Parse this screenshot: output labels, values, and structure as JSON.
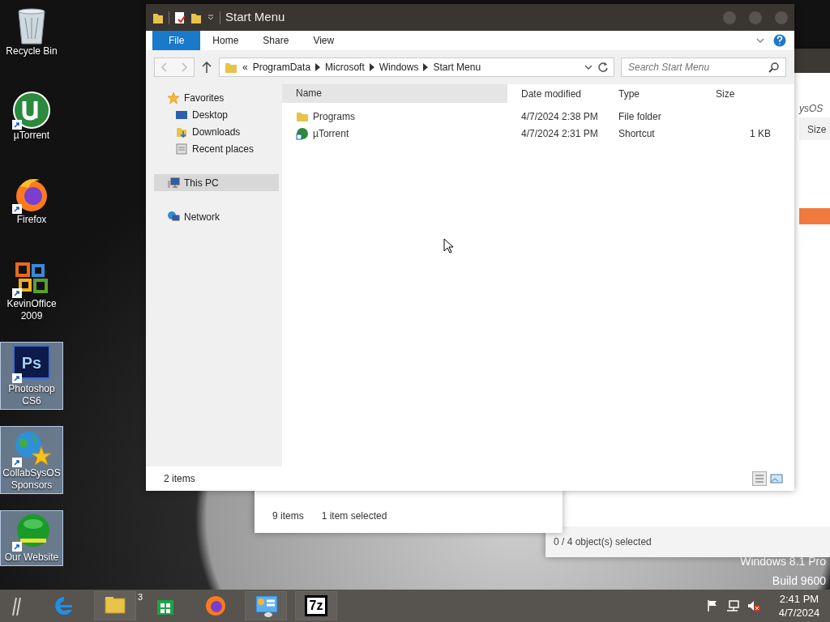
{
  "desktop": {
    "icons": [
      {
        "label": "Recycle Bin",
        "kind": "bin",
        "shortcut": false,
        "selected": false
      },
      {
        "label": "µTorrent",
        "kind": "utorrent",
        "shortcut": true,
        "selected": false
      },
      {
        "label": "Firefox",
        "kind": "firefox",
        "shortcut": true,
        "selected": false
      },
      {
        "label": "KevinOffice 2009",
        "kind": "office",
        "shortcut": true,
        "selected": false
      },
      {
        "label": "Photoshop CS6",
        "kind": "photoshop",
        "icon_text": "Ps",
        "shortcut": true,
        "selected": true
      },
      {
        "label": "CollabSysOS Sponsors",
        "kind": "globe",
        "shortcut": true,
        "selected": true
      },
      {
        "label": "Our Website",
        "kind": "website",
        "shortcut": true,
        "selected": true
      }
    ],
    "os_label": [
      "Windows 8.1 Pro",
      "Build 9600"
    ]
  },
  "back_window_right": {
    "heading": "ysOS",
    "column": "Size",
    "status": "0 / 4 object(s) selected"
  },
  "back_window_left": {
    "status": [
      "9 items",
      "1 item selected"
    ]
  },
  "explorer": {
    "title": "Start Menu",
    "ribbon_tabs": [
      {
        "label": "File",
        "selected": true
      },
      {
        "label": "Home",
        "selected": false
      },
      {
        "label": "Share",
        "selected": false
      },
      {
        "label": "View",
        "selected": false
      }
    ],
    "address": {
      "overflow": "«",
      "crumbs": [
        "ProgramData",
        "Microsoft",
        "Windows",
        "Start Menu"
      ]
    },
    "search": {
      "placeholder": "Search Start Menu"
    },
    "nav": [
      {
        "label": "Favorites",
        "kind": "star",
        "selected": false,
        "children": [
          {
            "label": "Desktop",
            "kind": "desktop",
            "selected": false
          },
          {
            "label": "Downloads",
            "kind": "downloads",
            "selected": false
          },
          {
            "label": "Recent places",
            "kind": "recent",
            "selected": false
          }
        ]
      },
      {
        "label": "This PC",
        "kind": "pc",
        "selected": true
      },
      {
        "label": "Network",
        "kind": "network",
        "selected": false
      }
    ],
    "columns": [
      "Name",
      "Date modified",
      "Type",
      "Size"
    ],
    "rows": [
      {
        "kind": "folder",
        "name": "Programs",
        "date": "4/7/2024 2:38 PM",
        "type": "File folder",
        "size": ""
      },
      {
        "kind": "shortcut",
        "name": "µTorrent",
        "date": "4/7/2024 2:31 PM",
        "type": "Shortcut",
        "size": "1 KB"
      }
    ],
    "status": "2 items"
  },
  "taskbar": {
    "apps": [
      {
        "kind": "ie"
      },
      {
        "kind": "explorer",
        "badge": "3"
      },
      {
        "kind": "store"
      },
      {
        "kind": "firefox"
      },
      {
        "kind": "control"
      },
      {
        "kind": "sevenzip",
        "text": "7z"
      }
    ],
    "time": "2:41 PM",
    "date": "4/7/2024"
  }
}
